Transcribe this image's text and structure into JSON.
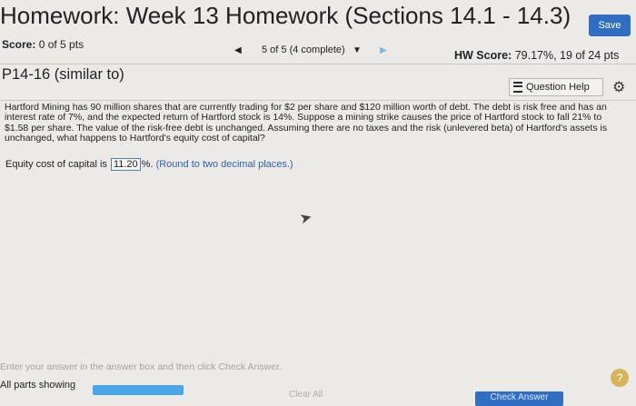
{
  "header": {
    "title": "Homework: Week 13 Homework (Sections 14.1 - 14.3)",
    "save_label": "Save"
  },
  "score": {
    "label": "Score:",
    "value": "0 of 5 pts"
  },
  "navigation": {
    "prev_icon": "triangle-left",
    "position_text": "5 of 5 (4 complete)",
    "dropdown_icon": "triangle-down",
    "next_icon": "triangle-right"
  },
  "hw_score": {
    "label": "HW Score:",
    "value": "79.17%, 19 of 24 pts"
  },
  "question": {
    "id": "P14-16 (similar to)",
    "help_label": "Question Help",
    "help_icon": "list-icon",
    "settings_icon": "gear-icon",
    "text": "Hartford Mining has 90 million shares that are currently trading for $2 per share and $120 million worth of debt. The debt is risk free and has an interest rate of 7%, and the expected return of Hartford stock is 14%. Suppose a mining strike causes the price of Hartford stock to fall 21% to $1.58 per share. The value of the risk-free debt is unchanged. Assuming there are no taxes and the risk (unlevered beta) of Hartford's assets is unchanged, what happens to Hartford's equity cost of capital?",
    "answer_prefix": "Equity cost of capital is",
    "answer_value": "11.20",
    "answer_suffix": "%.",
    "answer_hint": "(Round to two decimal places.)"
  },
  "footer": {
    "hint": "Enter your answer in the answer box and then click Check Answer.",
    "parts_label": "All parts showing",
    "progress_fraction": 1.0,
    "clear_label": "Clear All",
    "check_label": "Check Answer",
    "help_icon_label": "?"
  },
  "colors": {
    "accent_blue": "#2f6ec3",
    "progress_blue": "#4aa6e6",
    "help_gold": "#d7b45a"
  }
}
